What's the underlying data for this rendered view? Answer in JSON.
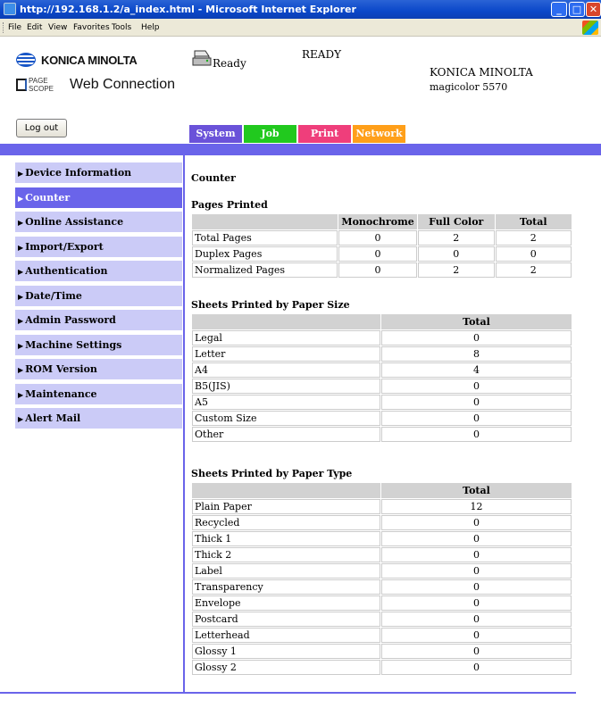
{
  "window": {
    "title": "http://192.168.1.2/a_index.html - Microsoft Internet Explorer",
    "menu": [
      "File",
      "Edit",
      "View",
      "Favorites",
      "Tools",
      "Help"
    ]
  },
  "header": {
    "brand": "KONICA MINOLTA",
    "webconnection_badge": "PAGE SCOPE",
    "webconnection": "Web Connection",
    "status_ready": "Ready",
    "status_caps": "READY",
    "model_brand": "KONICA MINOLTA",
    "model_name": "magicolor 5570",
    "logout": "Log out"
  },
  "tabs": [
    "System",
    "Job",
    "Print",
    "Network"
  ],
  "colors": {
    "accent": "#6a64ea",
    "sidebar_bg": "#cbcbf7",
    "tab_system": "#6a52d9",
    "tab_job": "#21c91e",
    "tab_print": "#ef3e7b",
    "tab_network": "#ff9f19"
  },
  "sidebar": {
    "items": [
      {
        "label": "Device Information",
        "active": false
      },
      {
        "label": "Counter",
        "active": true
      },
      {
        "label": "Online Assistance",
        "active": false
      },
      {
        "label": "Import/Export",
        "active": false
      },
      {
        "label": "Authentication",
        "active": false
      },
      {
        "label": "Date/Time",
        "active": false
      },
      {
        "label": "Admin Password",
        "active": false
      },
      {
        "label": "Machine Settings",
        "active": false
      },
      {
        "label": "ROM Version",
        "active": false
      },
      {
        "label": "Maintenance",
        "active": false
      },
      {
        "label": "Alert Mail",
        "active": false
      }
    ]
  },
  "main": {
    "title": "Counter",
    "pages_printed": {
      "title": "Pages Printed",
      "headers": [
        "",
        "Monochrome",
        "Full Color",
        "Total"
      ],
      "rows": [
        [
          "Total Pages",
          "0",
          "2",
          "2"
        ],
        [
          "Duplex Pages",
          "0",
          "0",
          "0"
        ],
        [
          "Normalized Pages",
          "0",
          "2",
          "2"
        ]
      ]
    },
    "by_size": {
      "title": "Sheets Printed by Paper Size",
      "headers": [
        "",
        "Total"
      ],
      "rows": [
        [
          "Legal",
          "0"
        ],
        [
          "Letter",
          "8"
        ],
        [
          "A4",
          "4"
        ],
        [
          "B5(JIS)",
          "0"
        ],
        [
          "A5",
          "0"
        ],
        [
          "Custom Size",
          "0"
        ],
        [
          "Other",
          "0"
        ]
      ]
    },
    "by_type": {
      "title": "Sheets Printed by Paper Type",
      "headers": [
        "",
        "Total"
      ],
      "rows": [
        [
          "Plain Paper",
          "12"
        ],
        [
          "Recycled",
          "0"
        ],
        [
          "Thick 1",
          "0"
        ],
        [
          "Thick 2",
          "0"
        ],
        [
          "Label",
          "0"
        ],
        [
          "Transparency",
          "0"
        ],
        [
          "Envelope",
          "0"
        ],
        [
          "Postcard",
          "0"
        ],
        [
          "Letterhead",
          "0"
        ],
        [
          "Glossy 1",
          "0"
        ],
        [
          "Glossy 2",
          "0"
        ]
      ]
    }
  }
}
